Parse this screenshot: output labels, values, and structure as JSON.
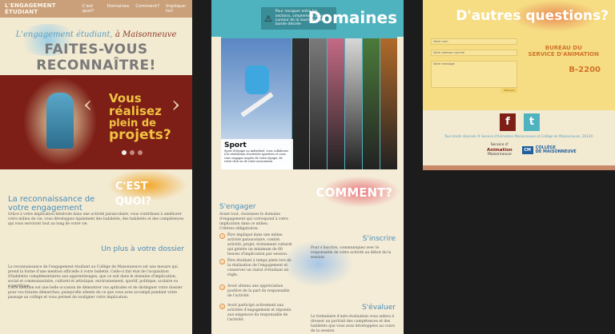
{
  "panel1": {
    "brand": "L'ENGAGEMENT ÉTUDIANT",
    "nav": [
      "C'est quoi?",
      "Domaines",
      "Comment?",
      "Implique-toi!"
    ],
    "tagline_pre": "L'engagement étudiant,",
    "tagline_post": "à Maisonneuve",
    "title": "FAITES-VOUS RECONNAÎTRE!",
    "slogan": [
      "Vous réalisez",
      "plein de",
      "projets?"
    ],
    "section_heading": "C'EST QUOI?",
    "subheading": "La reconnaissance de votre engagement",
    "body1": "Grâce à votre implication bénévole dans une activité parascolaire, vous contribuez à améliorer votre milieu de vie, vous développez également des habiletés, des habiletés et des compétences qui vous serviront tout au long de votre vie.",
    "subheading2": "Un plus à votre dossier",
    "body2": "La reconnaissance de l'engagement étudiant au Collège de Maisonneuve est une mesure qui prend la forme d'une mention officielle à votre bulletin. Celle-ci fait état de l'acquisition d'habiletés complémentaires aux apprentissages, que ce soit dans le domaine d'implication: social et communautaire, culturel et artistique, environnement, sportif, politique, scolaire ou scientifique.",
    "body3": "Cette mention est une belle occasion de démontrer vos aptitudes et de distinguer votre dossier pour vos futures démarches, puisqu'elle atteste de ce que vous avez accompli pendant votre passage au collège et vous permet de souligner votre implication."
  },
  "panel2": {
    "notice": "Pour naviguer entre les sections, simplement placer le curseur de la souris sur la bande désirée",
    "title": "Domaines",
    "feature_title": "Sport",
    "feature_text": "Sport d'équipe ou individuel, vous collaborez à la réalisation d'activités sportives et vous vous engagez auprès de votre équipe, de votre club ou de votre association.",
    "strip_colors": [
      "#2f2f2f",
      "#7a7a7a",
      "#c46a85",
      "#d8d8d8",
      "#4b7a3b",
      "#b06a2a"
    ],
    "section_heading": "COMMENT?",
    "sub1": "S'engager",
    "intro": "Avant tout, choisissez le domaine d'engagement qui correspond à votre implication dans ce milieu.",
    "criteria": "Critères obligatoires:",
    "items": [
      "Être impliqué dans une même activité parascolaire, comité, activité, projet, événement culturel qui génère un minimum de 60 heures d'implication par session.",
      "Être étudiant à temps plein lors de la réalisation de l'engagement et conserver un statut d'étudiant en règle.",
      "Avoir obtenu une appréciation positive de la part du responsable de l'activité.",
      "Avoir participé activement aux activités d'engagement et répondu aux exigences du responsable de l'activité."
    ],
    "sub2": "S'inscrire",
    "inscrire_text": "Pour s'inscrire, communiquez avec le responsable de votre activité au début de la session.",
    "sub3": "S'évaluer",
    "evaluer_text": "Le formulaire d'auto-évaluation vous aidera à dresser un portrait des compétences et des habiletés que vous avez développées au cours de la session."
  },
  "panel3": {
    "title": "D'autres questions?",
    "fields": [
      "Votre nom",
      "Votre adresse courriel",
      "Votre message"
    ],
    "send": "Envoyer",
    "office": [
      "BUREAU DU",
      "SERVICE D'ANIMATION"
    ],
    "room": "B-2200",
    "social": [
      "f",
      "t"
    ],
    "copyright": "Tous droits réservés ® Service d'Animation Maisonneuve et Collège de Maisonneuve, 2013©",
    "logo1_top": "Service d'",
    "logo1_main": "Animation",
    "logo1_bottom": "Maisonneuve",
    "logo2_mark": "CM",
    "logo2_line1": "COLLÈGE",
    "logo2_line2": "DE MAISONNEUVE"
  },
  "colors": {
    "teal": "#4fb3bf",
    "maroon": "#7e1f17",
    "cream": "#f3ead2",
    "yellow": "#f6dd84",
    "blue_text": "#4b8db5"
  }
}
